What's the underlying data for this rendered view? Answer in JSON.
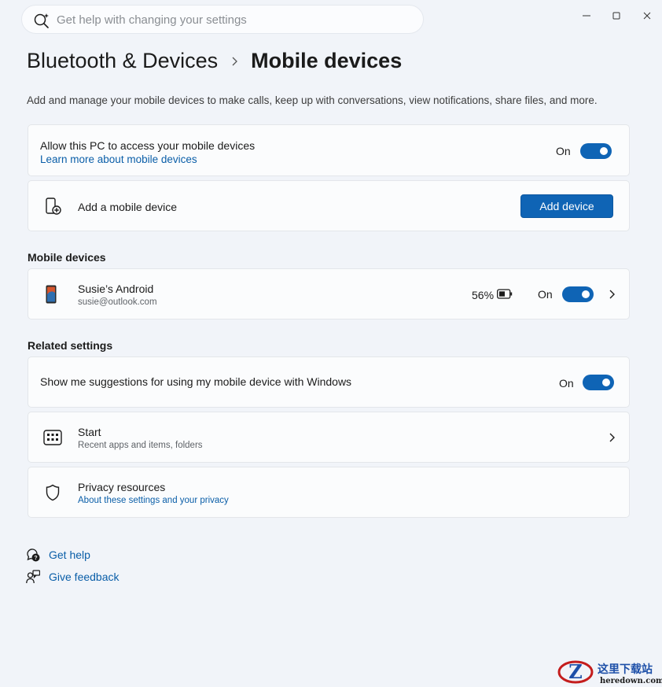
{
  "search": {
    "placeholder": "Get help with changing your settings",
    "icon": "search-sparkle-icon"
  },
  "window": {
    "minimize_icon": "minimize-icon",
    "maximize_icon": "maximize-icon",
    "close_icon": "close-icon"
  },
  "breadcrumb": {
    "parent": "Bluetooth & Devices",
    "current": "Mobile devices"
  },
  "description": "Add and manage your mobile devices to make calls, keep up with conversations, view notifications, share files, and more.",
  "access": {
    "title": "Allow this PC to access your mobile devices",
    "link": "Learn more about mobile devices",
    "state": "On"
  },
  "add_device": {
    "title": "Add a mobile device",
    "button": "Add device",
    "icon": "phone-add-icon"
  },
  "mobile_devices": {
    "heading": "Mobile devices",
    "devices": [
      {
        "name": "Susie’s Android",
        "account": "susie@outlook.com",
        "battery": "56%",
        "state": "On",
        "icon": "android-phone-icon"
      }
    ]
  },
  "related": {
    "heading": "Related settings",
    "suggestions": {
      "title": "Show me suggestions for using my mobile device with Windows",
      "state": "On"
    },
    "start": {
      "title": "Start",
      "subtitle": "Recent apps and items, folders",
      "icon": "start-grid-icon"
    },
    "privacy": {
      "title": "Privacy resources",
      "link": "About these settings and your privacy",
      "icon": "shield-icon"
    }
  },
  "footer": {
    "get_help": "Get help",
    "give_feedback": "Give feedback"
  },
  "colors": {
    "accent": "#0f64b5",
    "link": "#0a5ea8",
    "background": "#f1f4f9",
    "card": "#fbfcfd"
  },
  "watermark": {
    "text": "这里下载站",
    "domain": "heredown.com"
  }
}
